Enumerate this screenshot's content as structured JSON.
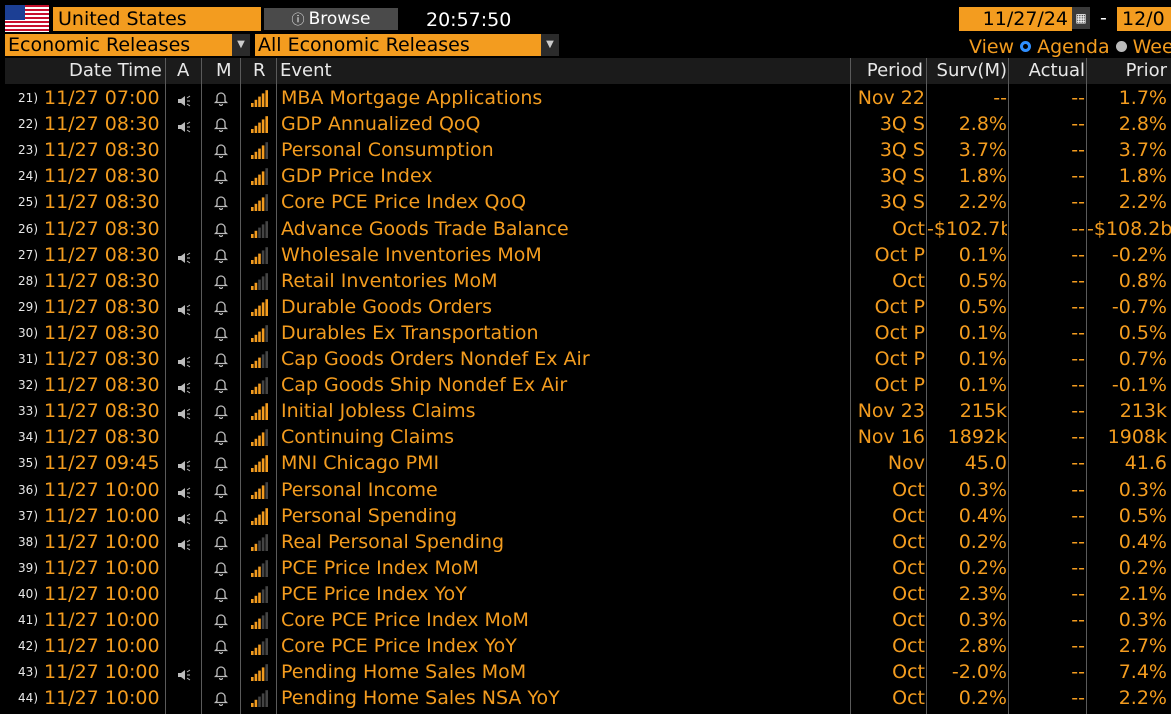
{
  "header": {
    "country": "United States",
    "browse_label": "Browse",
    "time": "20:57:50",
    "start_date": "11/27/24",
    "date_separator": "-",
    "end_date": "12/0",
    "filter_category": "Economic Releases",
    "filter_scope": "All Economic Releases",
    "view_label": "View",
    "view_options": [
      "Agenda",
      "Wee"
    ],
    "view_selected": "Agenda"
  },
  "colors": {
    "accent": "#f39c1f",
    "header_bg": "#1b1b1b",
    "radio_on": "#2f8fff"
  },
  "columns": {
    "date_time": "Date Time",
    "a": "A",
    "m": "M",
    "r": "R",
    "event": "Event",
    "period": "Period",
    "survey": "Surv(M)",
    "actual": "Actual",
    "prior": "Prior"
  },
  "rows": [
    {
      "num": "21)",
      "dt": "11/27 07:00",
      "alert": true,
      "rel": 5,
      "event": "MBA Mortgage Applications",
      "period": "Nov 22",
      "survey": "--",
      "actual": "--",
      "prior": "1.7%"
    },
    {
      "num": "22)",
      "dt": "11/27 08:30",
      "alert": true,
      "rel": 5,
      "event": "GDP Annualized QoQ",
      "period": "3Q S",
      "survey": "2.8%",
      "actual": "--",
      "prior": "2.8%"
    },
    {
      "num": "23)",
      "dt": "11/27 08:30",
      "alert": false,
      "rel": 4,
      "event": "Personal Consumption",
      "period": "3Q S",
      "survey": "3.7%",
      "actual": "--",
      "prior": "3.7%"
    },
    {
      "num": "24)",
      "dt": "11/27 08:30",
      "alert": false,
      "rel": 4,
      "event": "GDP Price Index",
      "period": "3Q S",
      "survey": "1.8%",
      "actual": "--",
      "prior": "1.8%"
    },
    {
      "num": "25)",
      "dt": "11/27 08:30",
      "alert": false,
      "rel": 4,
      "event": "Core PCE Price Index QoQ",
      "period": "3Q S",
      "survey": "2.2%",
      "actual": "--",
      "prior": "2.2%"
    },
    {
      "num": "26)",
      "dt": "11/27 08:30",
      "alert": false,
      "rel": 2,
      "event": "Advance Goods Trade Balance",
      "period": "Oct",
      "survey": "-$102.7b",
      "actual": "--",
      "prior": "-$108.2b"
    },
    {
      "num": "27)",
      "dt": "11/27 08:30",
      "alert": true,
      "rel": 3,
      "event": "Wholesale Inventories MoM",
      "period": "Oct P",
      "survey": "0.1%",
      "actual": "--",
      "prior": "-0.2%"
    },
    {
      "num": "28)",
      "dt": "11/27 08:30",
      "alert": false,
      "rel": 2,
      "event": "Retail Inventories MoM",
      "period": "Oct",
      "survey": "0.5%",
      "actual": "--",
      "prior": "0.8%"
    },
    {
      "num": "29)",
      "dt": "11/27 08:30",
      "alert": true,
      "rel": 5,
      "event": "Durable Goods Orders",
      "period": "Oct P",
      "survey": "0.5%",
      "actual": "--",
      "prior": "-0.7%"
    },
    {
      "num": "30)",
      "dt": "11/27 08:30",
      "alert": false,
      "rel": 4,
      "event": "Durables Ex Transportation",
      "period": "Oct P",
      "survey": "0.1%",
      "actual": "--",
      "prior": "0.5%"
    },
    {
      "num": "31)",
      "dt": "11/27 08:30",
      "alert": true,
      "rel": 3,
      "event": "Cap Goods Orders Nondef Ex Air",
      "period": "Oct P",
      "survey": "0.1%",
      "actual": "--",
      "prior": "0.7%"
    },
    {
      "num": "32)",
      "dt": "11/27 08:30",
      "alert": true,
      "rel": 3,
      "event": "Cap Goods Ship Nondef Ex Air",
      "period": "Oct P",
      "survey": "0.1%",
      "actual": "--",
      "prior": "-0.1%"
    },
    {
      "num": "33)",
      "dt": "11/27 08:30",
      "alert": true,
      "rel": 5,
      "event": "Initial Jobless Claims",
      "period": "Nov 23",
      "survey": "215k",
      "actual": "--",
      "prior": "213k"
    },
    {
      "num": "34)",
      "dt": "11/27 08:30",
      "alert": false,
      "rel": 4,
      "event": "Continuing Claims",
      "period": "Nov 16",
      "survey": "1892k",
      "actual": "--",
      "prior": "1908k"
    },
    {
      "num": "35)",
      "dt": "11/27 09:45",
      "alert": true,
      "rel": 5,
      "event": "MNI Chicago PMI",
      "period": "Nov",
      "survey": "45.0",
      "actual": "--",
      "prior": "41.6"
    },
    {
      "num": "36)",
      "dt": "11/27 10:00",
      "alert": true,
      "rel": 4,
      "event": "Personal Income",
      "period": "Oct",
      "survey": "0.3%",
      "actual": "--",
      "prior": "0.3%"
    },
    {
      "num": "37)",
      "dt": "11/27 10:00",
      "alert": true,
      "rel": 5,
      "event": "Personal Spending",
      "period": "Oct",
      "survey": "0.4%",
      "actual": "--",
      "prior": "0.5%"
    },
    {
      "num": "38)",
      "dt": "11/27 10:00",
      "alert": true,
      "rel": 2,
      "event": "Real Personal Spending",
      "period": "Oct",
      "survey": "0.2%",
      "actual": "--",
      "prior": "0.4%"
    },
    {
      "num": "39)",
      "dt": "11/27 10:00",
      "alert": false,
      "rel": 3,
      "event": "PCE Price Index MoM",
      "period": "Oct",
      "survey": "0.2%",
      "actual": "--",
      "prior": "0.2%"
    },
    {
      "num": "40)",
      "dt": "11/27 10:00",
      "alert": false,
      "rel": 3,
      "event": "PCE Price Index YoY",
      "period": "Oct",
      "survey": "2.3%",
      "actual": "--",
      "prior": "2.1%"
    },
    {
      "num": "41)",
      "dt": "11/27 10:00",
      "alert": false,
      "rel": 3,
      "event": "Core PCE Price Index MoM",
      "period": "Oct",
      "survey": "0.3%",
      "actual": "--",
      "prior": "0.3%"
    },
    {
      "num": "42)",
      "dt": "11/27 10:00",
      "alert": false,
      "rel": 3,
      "event": "Core PCE Price Index YoY",
      "period": "Oct",
      "survey": "2.8%",
      "actual": "--",
      "prior": "2.7%"
    },
    {
      "num": "43)",
      "dt": "11/27 10:00",
      "alert": true,
      "rel": 4,
      "event": "Pending Home Sales MoM",
      "period": "Oct",
      "survey": "-2.0%",
      "actual": "--",
      "prior": "7.4%"
    },
    {
      "num": "44)",
      "dt": "11/27 10:00",
      "alert": false,
      "rel": 2,
      "event": "Pending Home Sales NSA YoY",
      "period": "Oct",
      "survey": "0.2%",
      "actual": "--",
      "prior": "2.2%"
    }
  ]
}
